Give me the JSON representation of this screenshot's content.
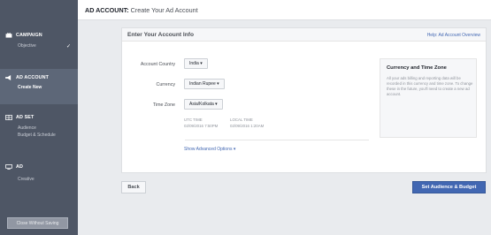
{
  "header": {
    "section": "AD ACCOUNT:",
    "title": "Create Your Ad Account"
  },
  "sidebar": {
    "sections": [
      {
        "label": "CAMPAIGN",
        "icon": "briefcase-icon",
        "items": [
          "Objective"
        ],
        "done": true
      },
      {
        "label": "AD ACCOUNT",
        "icon": "megaphone-icon",
        "items": [
          "Create New"
        ],
        "active": true
      },
      {
        "label": "AD SET",
        "icon": "grid-icon",
        "items": [
          "Audience",
          "Budget & Schedule"
        ]
      },
      {
        "label": "AD",
        "icon": "monitor-icon",
        "items": [
          "Creative"
        ]
      }
    ],
    "close_label": "Close Without Saving",
    "check": "✓"
  },
  "panel": {
    "title": "Enter Your Account Info",
    "help_link": "Help: Ad Account Overview",
    "fields": {
      "country": {
        "label": "Account Country",
        "value": "India ▾"
      },
      "currency": {
        "label": "Currency",
        "value": "Indian Rupee ▾"
      },
      "timezone": {
        "label": "Time Zone",
        "value": "Asia/Kolkata ▾"
      }
    },
    "utc": {
      "label": "UTC TIME",
      "value": "02/09/2016 7:50PM"
    },
    "local": {
      "label": "LOCAL TIME",
      "value": "02/09/2016 1:20AM"
    },
    "advanced": "Show Advanced Options ▾",
    "info": {
      "title": "Currency and Time Zone",
      "text": "All your ads billing and reporting data will be recorded in this currency and time zone. To change these in the future, you'll need to create a new ad account."
    }
  },
  "footer": {
    "back": "Back",
    "next": "Set Audience & Budget"
  },
  "colors": {
    "sidebar": "#4e5665",
    "accent": "#4267b2",
    "link": "#4267b2"
  }
}
